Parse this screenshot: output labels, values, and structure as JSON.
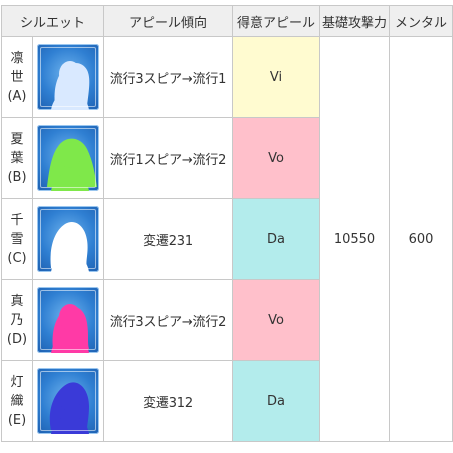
{
  "headers": [
    "シルエット",
    "アピール傾向",
    "得意アピール",
    "基礎攻撃力",
    "メンタル"
  ],
  "rows": [
    {
      "name_lines": [
        "凛",
        "世",
        "(A)"
      ],
      "silhouette_icon": "blue-silhouette",
      "silhouette_color": "#d9e9ff",
      "trend": "流行3スピア→流行1",
      "appeal": "Vi",
      "appeal_color": "#fffbd0"
    },
    {
      "name_lines": [
        "夏",
        "葉",
        "(B)"
      ],
      "silhouette_icon": "green-silhouette",
      "silhouette_color": "#7fe84a",
      "trend": "流行1スピア→流行2",
      "appeal": "Vo",
      "appeal_color": "#ffc0cb"
    },
    {
      "name_lines": [
        "千",
        "雪",
        "(C)"
      ],
      "silhouette_icon": "white-silhouette",
      "silhouette_color": "#ffffff",
      "trend": "変遷231",
      "appeal": "Da",
      "appeal_color": "#b3ecec"
    },
    {
      "name_lines": [
        "真",
        "乃",
        "(D)"
      ],
      "silhouette_icon": "pink-silhouette",
      "silhouette_color": "#ff3aa6",
      "trend": "流行3スピア→流行2",
      "appeal": "Vo",
      "appeal_color": "#ffc0cb"
    },
    {
      "name_lines": [
        "灯",
        "織",
        "(E)"
      ],
      "silhouette_icon": "indigo-silhouette",
      "silhouette_color": "#3a3ad8",
      "trend": "変遷312",
      "appeal": "Da",
      "appeal_color": "#b3ecec"
    }
  ],
  "base_attack": "10550",
  "mental": "600"
}
